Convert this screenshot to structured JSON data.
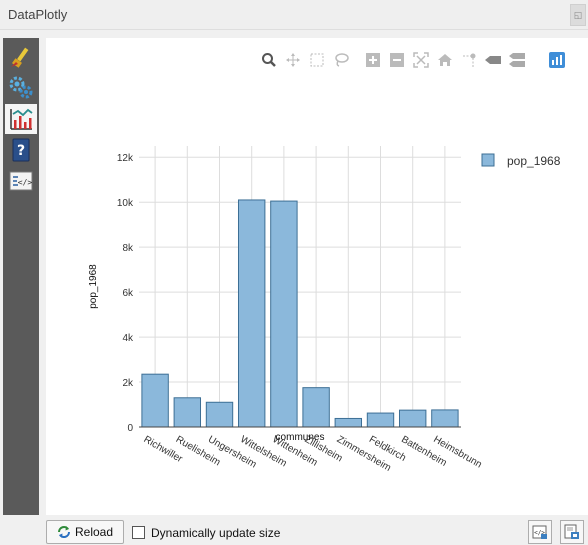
{
  "window": {
    "title": "DataPlotly"
  },
  "sidebar": {
    "items": [
      {
        "icon": "paintbrush-icon",
        "name": "style"
      },
      {
        "icon": "gears-icon",
        "name": "settings"
      },
      {
        "icon": "chart-icon",
        "name": "plot",
        "active": true
      },
      {
        "icon": "help-icon",
        "name": "help"
      },
      {
        "icon": "code-icon",
        "name": "code"
      }
    ]
  },
  "modebar": {
    "icons": [
      "zoom-icon",
      "pan-icon",
      "box-select-icon",
      "lasso-select-icon",
      "zoom-in-icon",
      "zoom-out-icon",
      "autoscale-icon",
      "reset-axes-icon",
      "spike-lines-icon",
      "hover-closest-icon",
      "hover-compare-icon",
      "plotly-logo-icon"
    ]
  },
  "chart_data": {
    "type": "bar",
    "categories": [
      "Richwiller",
      "Ruelisheim",
      "Ungersheim",
      "Wittelsheim",
      "Wittenheim",
      "Zillisheim",
      "Zimmersheim",
      "Feldkirch",
      "Battenheim",
      "Heimsbrunn"
    ],
    "series": [
      {
        "name": "pop_1968",
        "values": [
          2350,
          1300,
          1100,
          10100,
          10050,
          1750,
          380,
          620,
          750,
          760
        ]
      }
    ],
    "xlabel": "communes",
    "ylabel": "pop_1968",
    "ylim": [
      0,
      12500
    ],
    "yticks": [
      0,
      2000,
      4000,
      6000,
      8000,
      10000,
      12000
    ],
    "ytick_labels": [
      "0",
      "2k",
      "4k",
      "6k",
      "8k",
      "10k",
      "12k"
    ],
    "grid": true,
    "legend": "top-right",
    "colors": {
      "bar_fill": "#8bb8db",
      "bar_stroke": "#3d6f95",
      "grid": "#dddddd"
    }
  },
  "bottom": {
    "reload_label": "Reload",
    "dynamic_label": "Dynamically update size",
    "dynamic_checked": false
  }
}
